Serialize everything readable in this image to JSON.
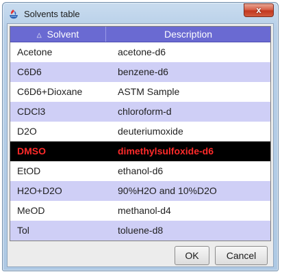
{
  "window": {
    "title": "Solvents table",
    "close_label": "x"
  },
  "table": {
    "columns": [
      {
        "label": "Solvent",
        "sort_icon": "sort-ascending-icon",
        "sort_glyph": "△"
      },
      {
        "label": "Description"
      }
    ],
    "rows": [
      {
        "solvent": "Acetone",
        "description": "acetone-d6",
        "selected": false
      },
      {
        "solvent": "C6D6",
        "description": "benzene-d6",
        "selected": false
      },
      {
        "solvent": "C6D6+Dioxane",
        "description": "ASTM Sample",
        "selected": false
      },
      {
        "solvent": "CDCl3",
        "description": "chloroform-d",
        "selected": false
      },
      {
        "solvent": "D2O",
        "description": "deuteriumoxide",
        "selected": false
      },
      {
        "solvent": "DMSO",
        "description": "dimethylsulfoxide-d6",
        "selected": true
      },
      {
        "solvent": "EtOD",
        "description": "ethanol-d6",
        "selected": false
      },
      {
        "solvent": "H2O+D2O",
        "description": "90%H2O and 10%D2O",
        "selected": false
      },
      {
        "solvent": "MeOD",
        "description": "methanol-d4",
        "selected": false
      },
      {
        "solvent": "Tol",
        "description": "toluene-d8",
        "selected": false
      }
    ],
    "colors": {
      "header": "#6a6ad2",
      "alt_row": "#cfcff6",
      "selected_bg": "#000000",
      "selected_text": "#ff2a2a"
    }
  },
  "buttons": {
    "ok_label": "OK",
    "cancel_label": "Cancel"
  }
}
